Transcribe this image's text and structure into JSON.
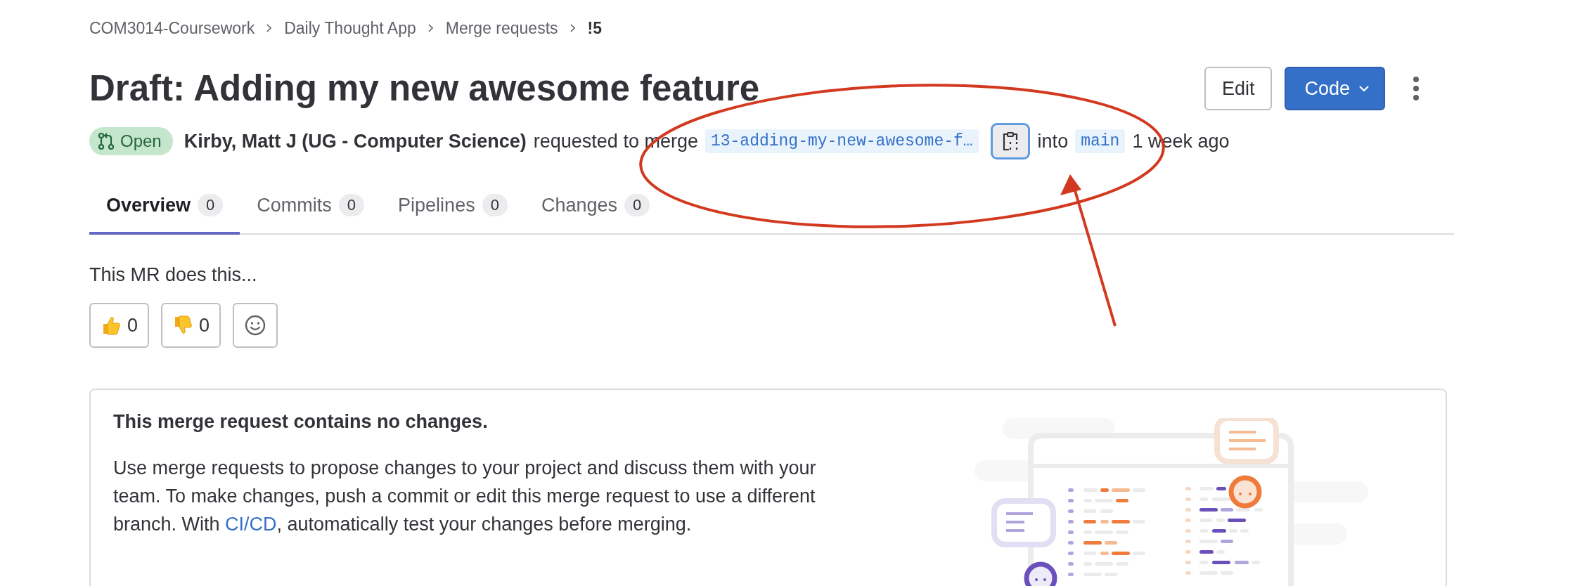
{
  "breadcrumbs": [
    {
      "label": "COM3014-Coursework",
      "current": false
    },
    {
      "label": "Daily Thought App",
      "current": false
    },
    {
      "label": "Merge requests",
      "current": false
    },
    {
      "label": "!5",
      "current": true
    }
  ],
  "title": "Draft: Adding my new awesome feature",
  "actions": {
    "edit": "Edit",
    "code": "Code"
  },
  "meta": {
    "status": "Open",
    "author": "Kirby, Matt J (UG - Computer Science)",
    "requested": "requested to merge",
    "source_branch": "13-adding-my-new-awesome-f…",
    "copy_focused": true,
    "into": "into",
    "target_branch": "main",
    "time": "1 week ago"
  },
  "tabs": [
    {
      "label": "Overview",
      "count": "0",
      "selected": true
    },
    {
      "label": "Commits",
      "count": "0",
      "selected": false
    },
    {
      "label": "Pipelines",
      "count": "0",
      "selected": false
    },
    {
      "label": "Changes",
      "count": "0",
      "selected": false
    }
  ],
  "description": "This MR does this...",
  "reactions": [
    {
      "kind": "thumbsup",
      "count": "0"
    },
    {
      "kind": "thumbsdown",
      "count": "0"
    },
    {
      "kind": "add"
    }
  ],
  "empty_state": {
    "heading": "This merge request contains no changes.",
    "body": "Use merge requests to propose changes to your project and discuss them with your team. To make changes, push a commit or edit this merge request to use a different branch. With ",
    "link": "CI/CD",
    "body_end": ", automatically test your changes before merging."
  },
  "annotation": {
    "shown": true
  }
}
